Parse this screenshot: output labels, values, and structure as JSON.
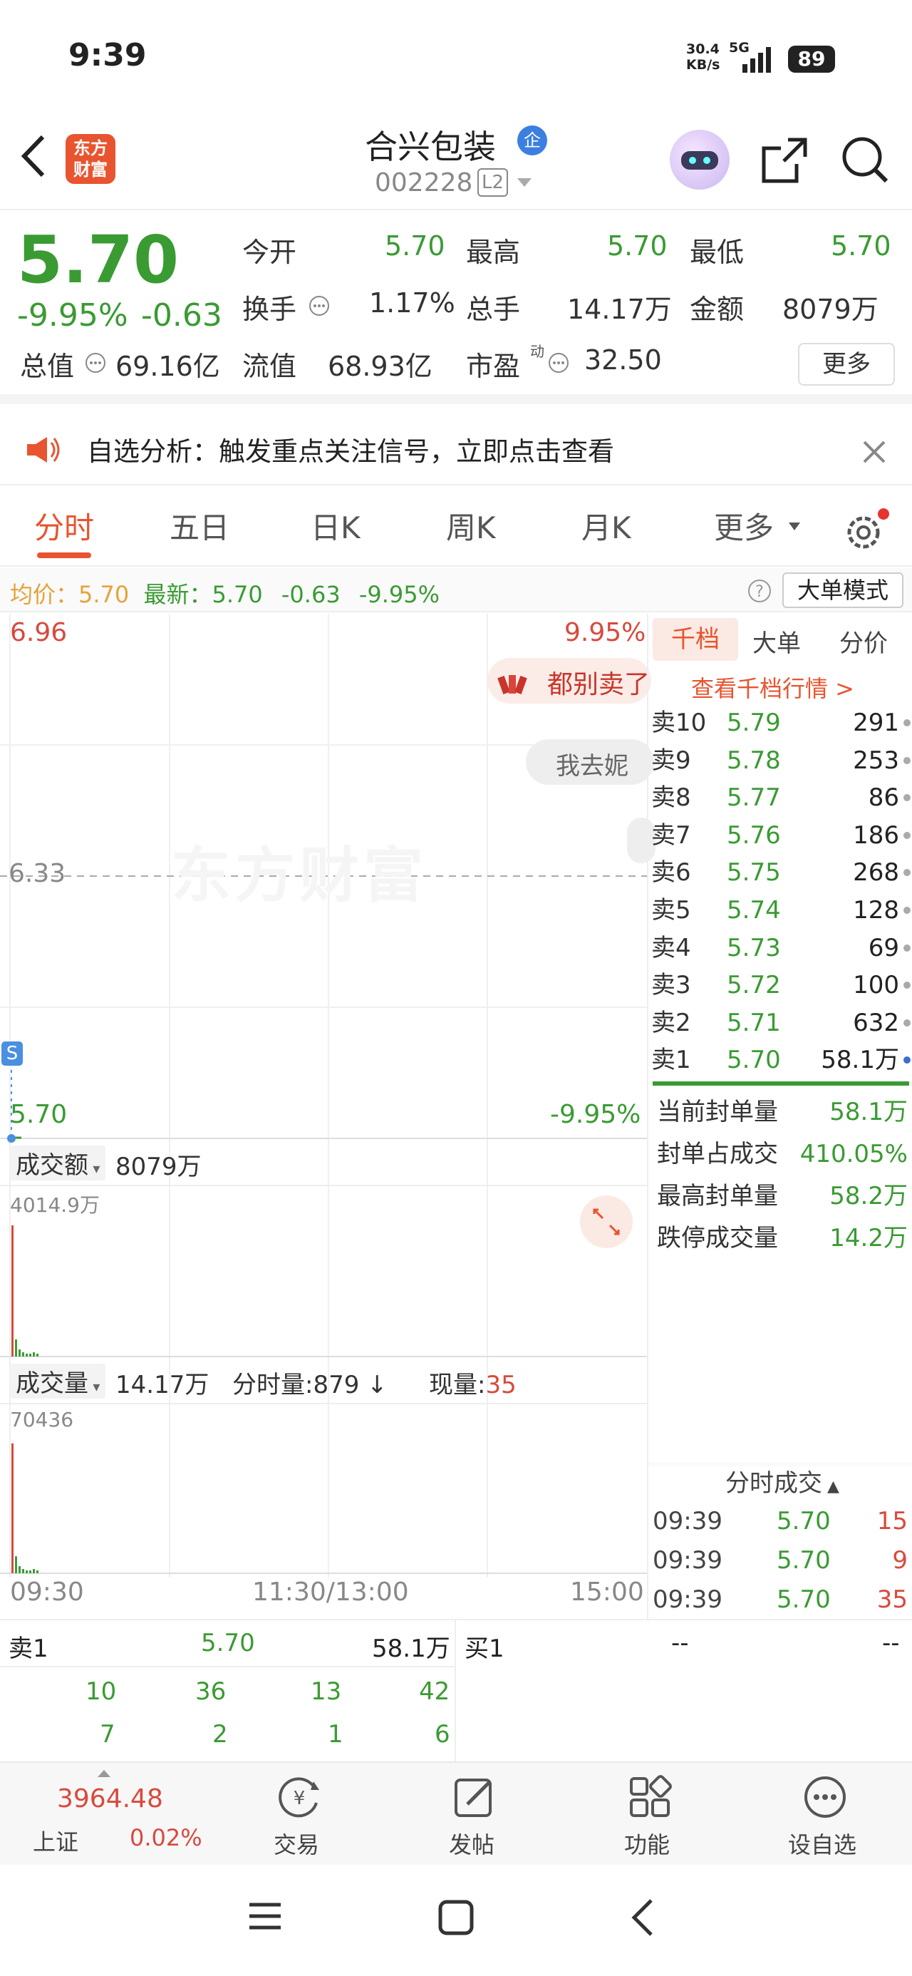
{
  "status": {
    "time": "9:39",
    "net_speed_top": "30.4",
    "net_speed_bottom": "KB/s",
    "network": "5G",
    "battery": "89"
  },
  "nav": {
    "logo_line1": "东方",
    "logo_line2": "财富",
    "stock_name": "合兴包装",
    "badge": "企",
    "code": "002228",
    "level": "L2"
  },
  "quote": {
    "price": "5.70",
    "change_pct": "-9.95%",
    "change": "-0.63",
    "open_label": "今开",
    "open": "5.70",
    "high_label": "最高",
    "high": "5.70",
    "low_label": "最低",
    "low": "5.70",
    "turnover_label": "换手",
    "turnover": "1.17%",
    "volume_label": "总手",
    "volume": "14.17万",
    "amount_label": "金额",
    "amount": "8079万",
    "mcap_label": "总值",
    "mcap": "69.16亿",
    "float_label": "流值",
    "float": "68.93亿",
    "pe_label": "市盈",
    "pe_sup": "动",
    "pe": "32.50",
    "more": "更多"
  },
  "notice": {
    "text": "自选分析：触发重点关注信号，立即点击查看"
  },
  "tabs": [
    "分时",
    "五日",
    "日K",
    "周K",
    "月K",
    "更多"
  ],
  "avgbar": {
    "avg_label": "均价：",
    "avg": "5.70",
    "last_label": "最新：",
    "last": "5.70",
    "chg": "-0.63",
    "pct": "-9.95%",
    "mode": "大单模式"
  },
  "chart": {
    "top_price": "6.96",
    "top_pct": "9.95%",
    "mid_price": "6.33",
    "bottom_price": "5.70",
    "bottom_pct": "-9.95%",
    "watermark": "东方财富",
    "bubble1": "都别卖了",
    "bubble2": "我去妮",
    "s_marker": "S",
    "amount_label": "成交额",
    "amount_value": "8079万",
    "amount_max": "4014.9万",
    "vol_label": "成交量",
    "vol_value": "14.17万",
    "vol_minute": "分时量:879 ↓",
    "vol_now_label": "现量:",
    "vol_now": "35",
    "vol_max": "70436",
    "time_start": "09:30",
    "time_mid": "11:30/13:00",
    "time_end": "15:00",
    "amount_bars": [
      0.92,
      0.12,
      0.05,
      0.03,
      0.02,
      0.02,
      0.03,
      0.02
    ],
    "vol_bars": [
      0.92,
      0.12,
      0.05,
      0.03,
      0.02,
      0.02,
      0.03,
      0.02
    ]
  },
  "book": {
    "tabs": [
      "千档",
      "大单",
      "分价"
    ],
    "link": "查看千档行情 >",
    "asks": [
      [
        "卖10",
        "5.79",
        "291"
      ],
      [
        "卖9",
        "5.78",
        "253"
      ],
      [
        "卖8",
        "5.77",
        "86"
      ],
      [
        "卖7",
        "5.76",
        "186"
      ],
      [
        "卖6",
        "5.75",
        "268"
      ],
      [
        "卖5",
        "5.74",
        "128"
      ],
      [
        "卖4",
        "5.73",
        "69"
      ],
      [
        "卖3",
        "5.72",
        "100"
      ],
      [
        "卖2",
        "5.71",
        "632"
      ],
      [
        "卖1",
        "5.70",
        "58.1万"
      ]
    ],
    "stats": [
      [
        "当前封单量",
        "58.1万"
      ],
      [
        "封单占成交",
        "410.05%"
      ],
      [
        "最高封单量",
        "58.2万"
      ],
      [
        "跌停成交量",
        "14.2万"
      ]
    ],
    "trades_title": "分时成交",
    "trades": [
      [
        "09:39",
        "5.70",
        "15"
      ],
      [
        "09:39",
        "5.70",
        "9"
      ],
      [
        "09:39",
        "5.70",
        "35"
      ]
    ]
  },
  "bottomq": {
    "ask_label": "卖1",
    "ask_price": "5.70",
    "ask_vol": "58.1万",
    "bid_label": "买1",
    "bid_price": "--",
    "bid_vol": "--",
    "row1": [
      "10",
      "36",
      "13",
      "42"
    ],
    "row2": [
      "7",
      "2",
      "1",
      "6"
    ]
  },
  "toolbar": {
    "index_value": "3964.48",
    "index_name": "上证",
    "index_pct": "0.02%",
    "trade": "交易",
    "post": "发帖",
    "func": "功能",
    "watch": "设自选"
  },
  "colors": {
    "red": "#d84a3d",
    "green": "#3a9b33",
    "accent": "#e8542f"
  }
}
